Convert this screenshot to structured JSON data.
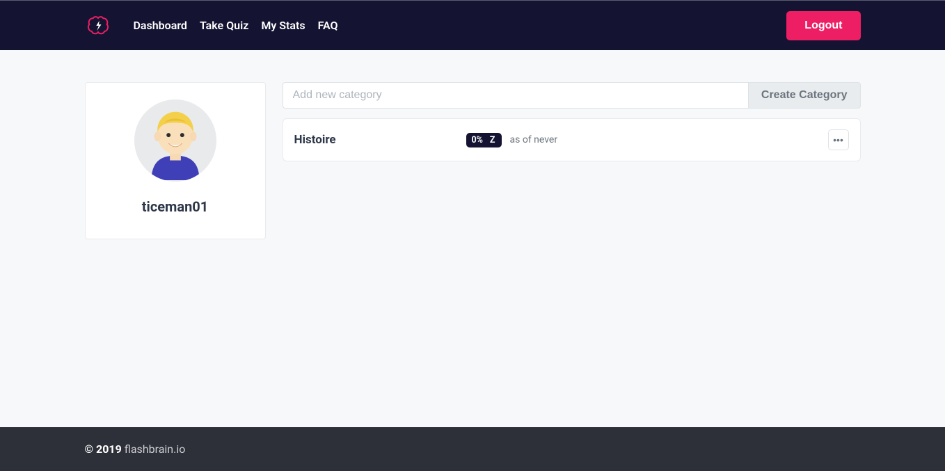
{
  "nav": {
    "links": [
      "Dashboard",
      "Take Quiz",
      "My Stats",
      "FAQ"
    ],
    "logout": "Logout"
  },
  "profile": {
    "username": "ticeman01"
  },
  "category_form": {
    "placeholder": "Add new category",
    "button": "Create Category"
  },
  "categories": [
    {
      "name": "Histoire",
      "percent": "0%",
      "flag": "Z",
      "asof": "as of never"
    }
  ],
  "footer": {
    "copyright": "© 2019 ",
    "site": "flashbrain.io"
  }
}
